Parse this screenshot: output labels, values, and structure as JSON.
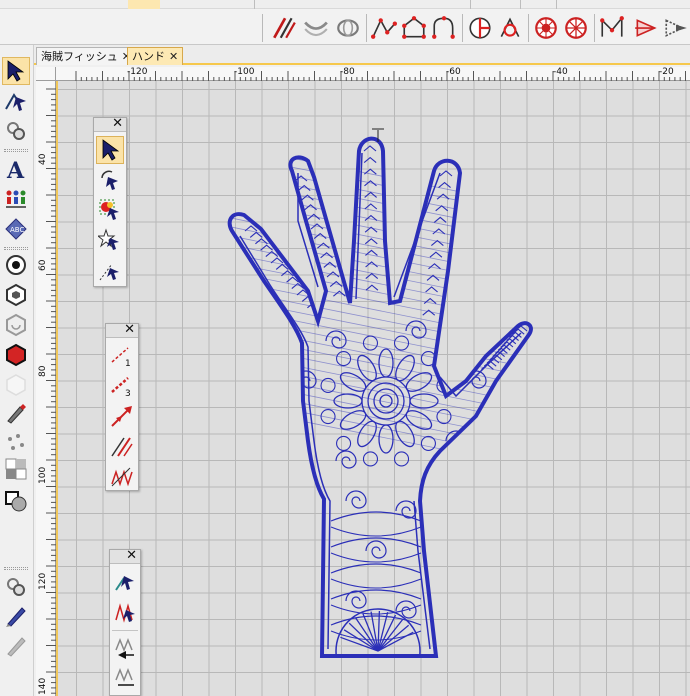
{
  "tabs": [
    {
      "label": "海賊フィッシュ",
      "close": "✕",
      "active": false
    },
    {
      "label": "ハンド",
      "close": "✕",
      "active": true
    }
  ],
  "ruler": {
    "horizontal": [
      "-120",
      "-100",
      "-80",
      "-60",
      "-40",
      "-20"
    ],
    "vertical": [
      "40",
      "60",
      "80",
      "100",
      "120",
      "140"
    ]
  },
  "palettes": {
    "selection": {
      "close": "✕"
    },
    "stitch": {
      "close": "✕",
      "badges": [
        "1",
        "3"
      ]
    },
    "edit": {
      "close": "✕"
    }
  },
  "colors": {
    "accent": "#f6c84c",
    "embroidery_blue": "#2b2fb8",
    "tab_active": "#fde9b4",
    "canvas": "#dedede",
    "grid": "#b8b8b8"
  },
  "icons": {
    "top_toolbar": [
      "line-stitch-icon",
      "bend-icon",
      "rotate-3d-icon",
      "node-path-icon",
      "house-shape-icon",
      "arc-icon",
      "circle-split-icon",
      "merge-icon",
      "star-circle-icon",
      "wheel-icon",
      "corner-icon",
      "arrow-right-icon",
      "fill-arrow-icon"
    ],
    "left_toolbar": [
      "select-arrow-icon",
      "reshape-icon",
      "bend-tool-icon",
      "text-icon",
      "team-names-icon",
      "monogram-icon",
      "circle-icon",
      "hexagon-icon",
      "spiral-hex-icon",
      "red-hexagon-icon",
      "white-hexagon-icon",
      "pen-icon",
      "scatter-icon",
      "color-swatch-icon",
      "shape-blend-icon",
      "edit-tool-icon",
      "pencil-icon",
      "knife-icon"
    ]
  }
}
